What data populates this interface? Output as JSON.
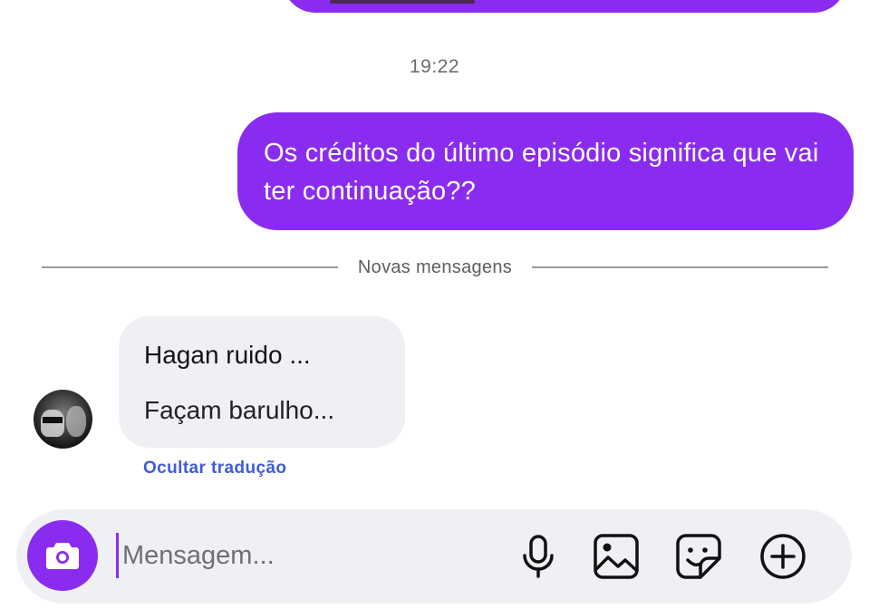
{
  "thread": {
    "timestamp": "19:22",
    "outgoing_message": "Os créditos do último episódio significa que vai ter continuação??",
    "divider_label": "Novas mensagens",
    "incoming_message": {
      "original": "Hagan ruido ...",
      "translation": "Façam barulho...",
      "hide_translation_label": "Ocultar tradução"
    }
  },
  "composer": {
    "placeholder": "Mensagem...",
    "icons": {
      "camera": "camera-icon",
      "mic": "microphone-icon",
      "gallery": "gallery-icon",
      "sticker": "sticker-icon",
      "more": "plus-circle-icon"
    }
  },
  "colors": {
    "accent": "#8a2cf0",
    "incoming_bubble": "#eff0f4",
    "link": "#3f5cd8"
  }
}
